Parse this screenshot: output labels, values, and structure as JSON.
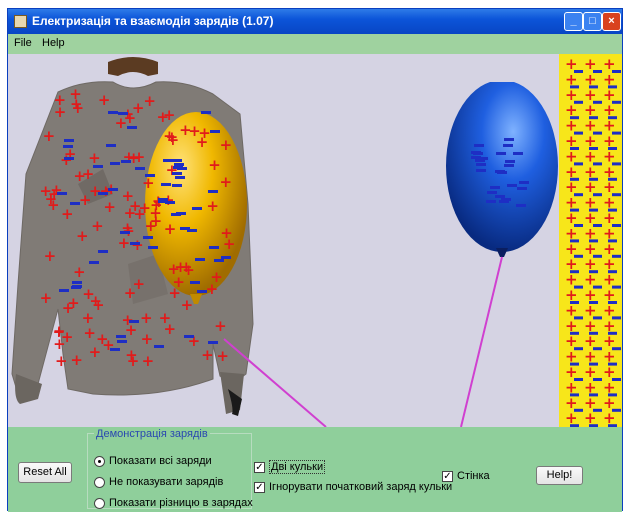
{
  "window": {
    "title": "Електризація та взаємодія зарядів (1.07)",
    "buttons": {
      "minimize": "_",
      "maximize": "□",
      "close": "×"
    }
  },
  "menu": {
    "file": "File",
    "help": "Help"
  },
  "controls": {
    "reset_label": "Reset All",
    "group_title": "Демонстрація зарядів",
    "radios": [
      {
        "label": "Показати всі заряди",
        "selected": true
      },
      {
        "label": "Не показувати зарядів",
        "selected": false
      },
      {
        "label": "Показати різницю в зарядах",
        "selected": false
      }
    ],
    "two_balloons": {
      "label": "Дві кульки",
      "checked": true
    },
    "ignore_initial": {
      "label": "Ігнорувати початковий заряд кульки",
      "checked": true
    },
    "wall": {
      "label": "Стінка",
      "checked": true
    },
    "help_label": "Help!"
  },
  "colors": {
    "canvas_bg": "#d5d3e3",
    "panel_bg": "#8fcf9b",
    "menubar_bg": "#9fd29f",
    "positive_charge": "#e11b1b",
    "negative_charge": "#1e2ec4",
    "wall": "#f7e61a",
    "yellow_balloon": "#f0b800",
    "blue_balloon": "#1548c8",
    "string": "#d040d0"
  }
}
